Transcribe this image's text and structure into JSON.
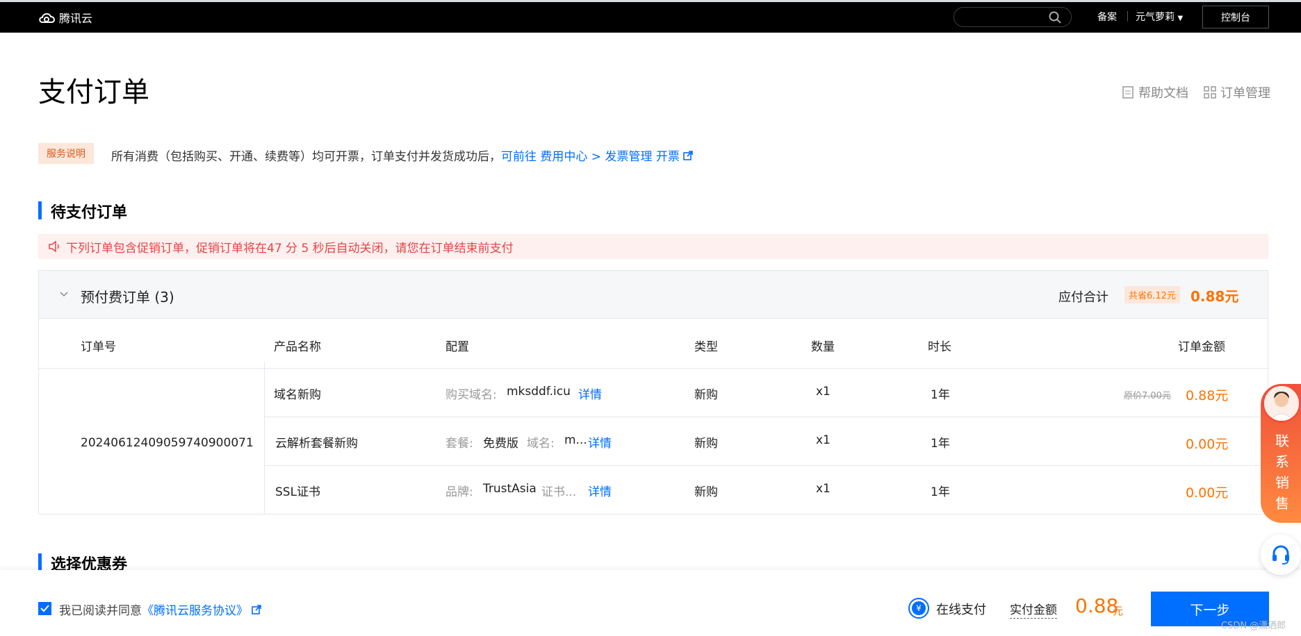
{
  "header": {
    "brand": "腾讯云",
    "links": [
      "备案",
      "元气萝莉"
    ],
    "console_label": "控制台"
  },
  "page": {
    "title": "支付订单",
    "help_link": "帮助文档",
    "orders_link": "订单管理"
  },
  "service_note": {
    "badge": "服务说明",
    "text": "所有消费（包括购买、开通、续费等）均可开票，订单支付并发货成功后，",
    "link": "可前往 费用中心 > 发票管理 开票"
  },
  "pending": {
    "title": "待支付订单",
    "alert": "下列订单包含促销订单，促销订单将在47 分  5  秒后自动关闭，请您在订单结束前支付"
  },
  "order_group": {
    "title": "预付费订单 (3)",
    "total_label": "应付合计",
    "save_badge": "共省6.12元",
    "total_value": "0.88元"
  },
  "table": {
    "headers": [
      "订单号",
      "产品名称",
      "配置",
      "类型",
      "数量",
      "时长",
      "订单金额"
    ],
    "order_no": "20240612409059740900071",
    "rows": [
      {
        "product": "域名新购",
        "cfg_label1": "购买域名:",
        "cfg_value1": "mksddf.icu",
        "cfg_label2": "",
        "cfg_value2": "",
        "detail": "详情",
        "type": "新购",
        "qty": "x1",
        "duration": "1年",
        "orig": "原价7.00元",
        "price": "0.88元"
      },
      {
        "product": "云解析套餐新购",
        "cfg_label1": "套餐:",
        "cfg_value1": "免费版",
        "cfg_label2": "域名:",
        "cfg_value2": "m...",
        "detail": "详情",
        "type": "新购",
        "qty": "x1",
        "duration": "1年",
        "orig": "",
        "price": "0.00元"
      },
      {
        "product": "SSL证书",
        "cfg_label1": "品牌:",
        "cfg_value1": "TrustAsia",
        "cfg_label2": "证书...",
        "cfg_value2": "",
        "detail": "详情",
        "type": "新购",
        "qty": "x1",
        "duration": "1年",
        "orig": "",
        "price": "0.00元"
      }
    ]
  },
  "coupon": {
    "title": "选择优惠券"
  },
  "footer": {
    "agree_text": "我已阅读并同意",
    "agreement_link": "《腾讯云服务协议》",
    "pay_method": "在线支付",
    "actual_label": "实付金额",
    "actual_value": "0.88",
    "actual_unit": "元",
    "next_label": "下一步",
    "watermark": "CSDN @潇洒郎"
  },
  "side": {
    "sales_text": "联系销售"
  },
  "colors": {
    "accent": "#006eff",
    "price": "#ff7200",
    "alert": "#e54545"
  }
}
